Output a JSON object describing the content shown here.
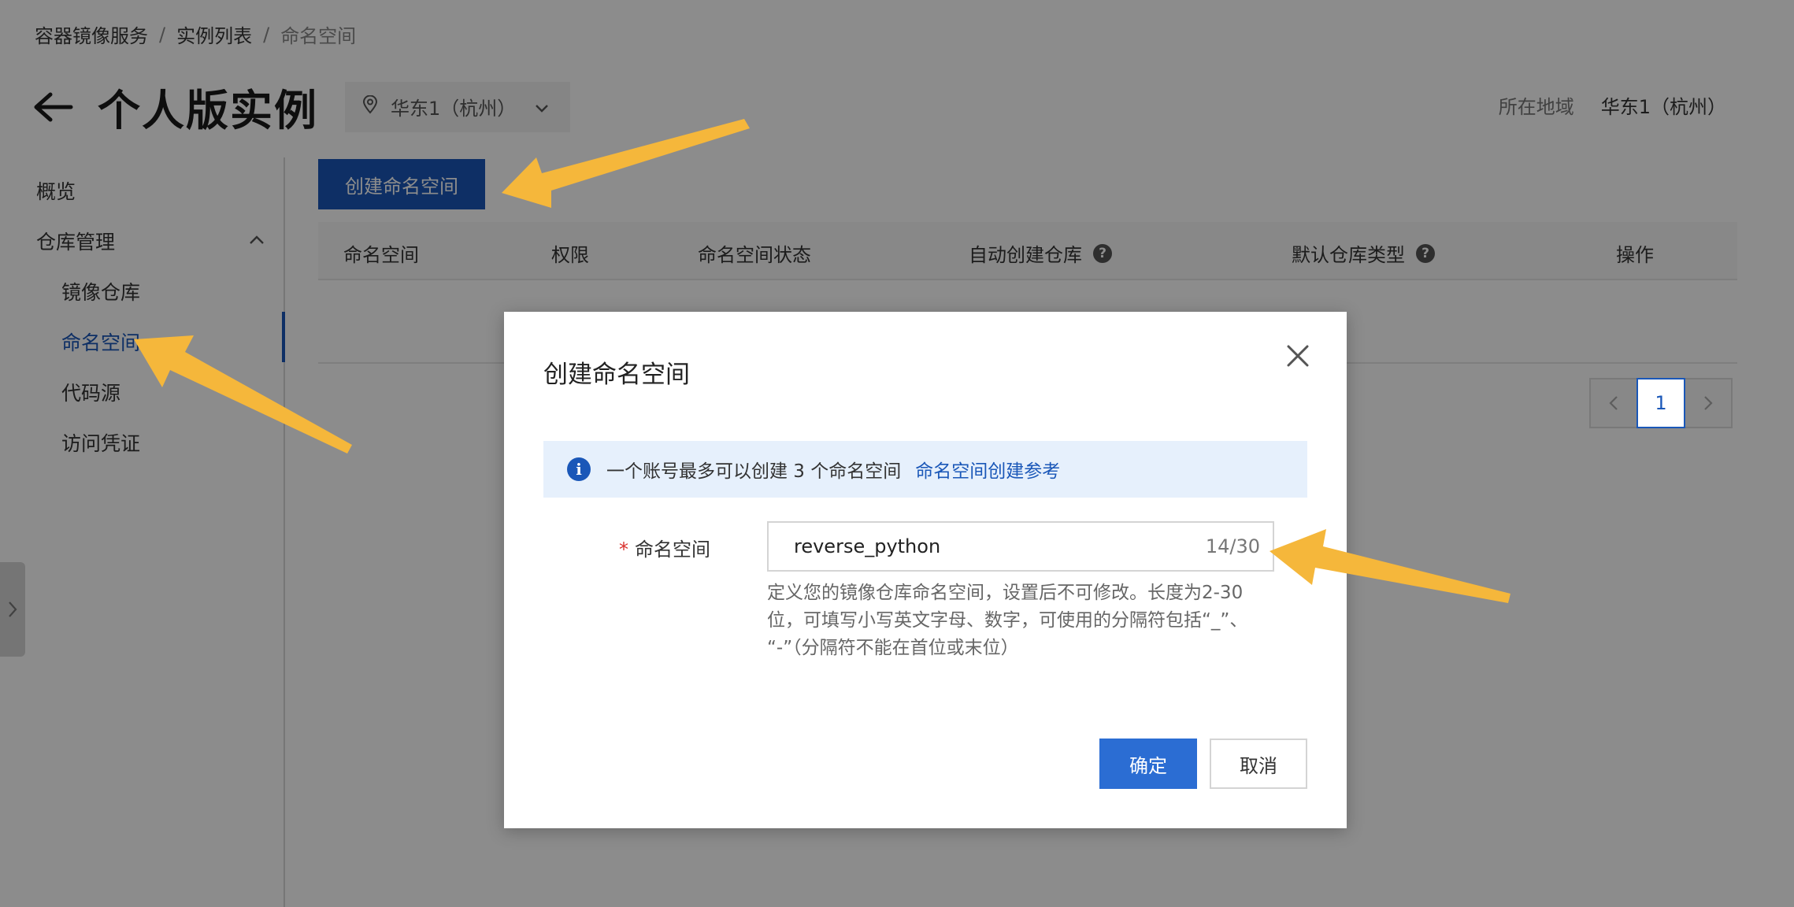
{
  "breadcrumb": {
    "items": [
      "容器镜像服务",
      "实例列表",
      "命名空间"
    ],
    "separator": "/"
  },
  "header": {
    "back_icon": "arrow-left-icon",
    "title": "个人版实例",
    "region_select": {
      "icon": "location-pin-icon",
      "value": "华东1（杭州）"
    }
  },
  "region_info": {
    "label": "所在地域",
    "value": "华东1（杭州）"
  },
  "sidebar": {
    "items": [
      {
        "label": "概览"
      },
      {
        "label": "仓库管理"
      },
      {
        "label": "镜像仓库"
      },
      {
        "label": "命名空间",
        "active": true
      },
      {
        "label": "代码源"
      },
      {
        "label": "访问凭证"
      }
    ]
  },
  "toolbar": {
    "create_label": "创建命名空间"
  },
  "table": {
    "columns": [
      "命名空间",
      "权限",
      "命名空间状态",
      "自动创建仓库",
      "默认仓库类型",
      "操作"
    ]
  },
  "pagination": {
    "current_page": "1"
  },
  "dialog": {
    "title": "创建命名空间",
    "info_text": "一个账号最多可以创建 3 个命名空间",
    "info_link": "命名空间创建参考",
    "field_required_mark": "*",
    "field_label": "命名空间",
    "field_value": "reverse_python",
    "field_counter": "14/30",
    "help_line1": "定义您的镜像仓库命名空间，设置后不可修改。长度为2-30",
    "help_line2": "位，可填写小写英文字母、数字，可使用的分隔符包括“_”、",
    "help_line3": "“-”（分隔符不能在首位或末位）",
    "ok_label": "确定",
    "cancel_label": "取消"
  },
  "colors": {
    "primary": "#1a57b8",
    "ok_button": "#2b6dd3",
    "info_bg": "#e6f0fc",
    "required": "#d9302c",
    "annotation_arrow": "#f5b73b"
  }
}
